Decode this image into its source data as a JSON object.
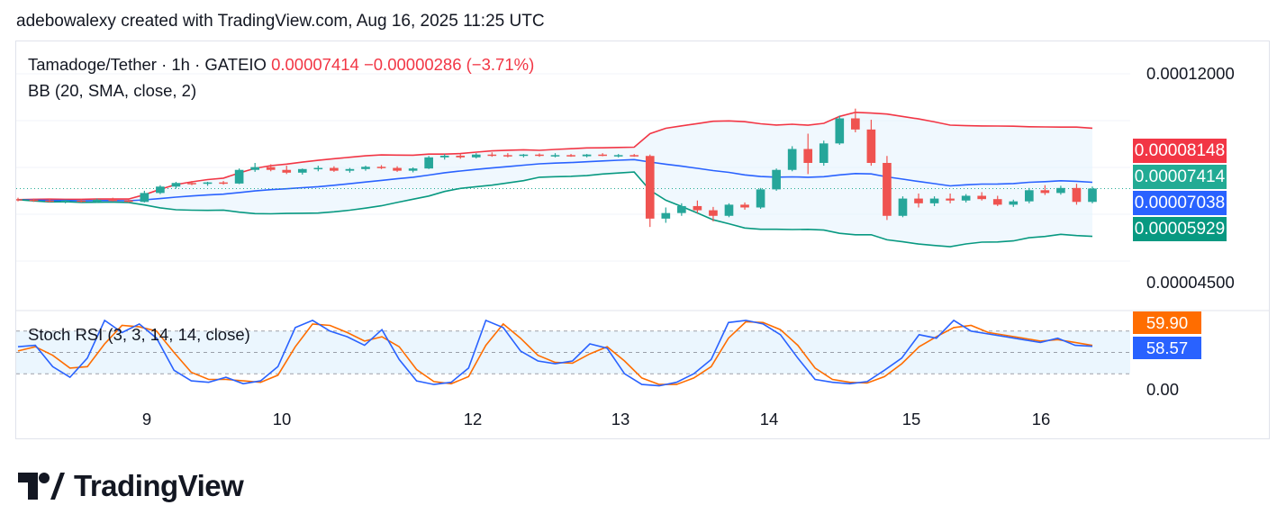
{
  "header": {
    "text": "adebowalexy created with TradingView.com, Aug 16, 2025 11:25 UTC"
  },
  "legend": {
    "symbol": "Tamadoge/Tether · 1h · GATEIO",
    "price": "0.00007414",
    "change": "−0.00000286 (−3.71%)",
    "indicator": "BB (20, SMA, close, 2)"
  },
  "stoch": {
    "title": "Stoch RSI (3, 3, 14, 14, close)"
  },
  "badges": {
    "upper": {
      "text": "0.00008148",
      "color": "#f23645"
    },
    "last": {
      "text": "0.00007414",
      "color": "#22ab94"
    },
    "basis": {
      "text": "0.00007038",
      "color": "#2962ff"
    },
    "lower": {
      "text": "0.00005929",
      "color": "#089981"
    },
    "stoch_d": {
      "text": "59.90",
      "color": "#ff6d00"
    },
    "stoch_k": {
      "text": "58.57",
      "color": "#2962ff"
    }
  },
  "colors": {
    "up": "#26a69a",
    "down": "#ef5350",
    "bb_upper": "#f23645",
    "bb_basis": "#2962ff",
    "bb_lower": "#089981",
    "band_fill": "#e3f2fd",
    "stoch_k": "#2962ff",
    "stoch_d": "#ff6d00"
  },
  "logo": {
    "text": "TradingView"
  },
  "chart_data": [
    {
      "type": "candlestick",
      "yaxis": {
        "ticks": [
          "0.00012000",
          "0.00004500"
        ]
      },
      "xaxis": {
        "ticks": [
          "9",
          "10",
          "12",
          "13",
          "14",
          "15",
          "16"
        ]
      },
      "candles": [
        [
          7.5e-05,
          7.55e-05,
          7.42e-05,
          7.48e-05
        ],
        [
          7.48e-05,
          7.52e-05,
          7.4e-05,
          7.45e-05
        ],
        [
          7.45e-05,
          7.5e-05,
          7.38e-05,
          7.42e-05
        ],
        [
          7.42e-05,
          7.48e-05,
          7.35e-05,
          7.45e-05
        ],
        [
          7.45e-05,
          7.5e-05,
          7.38e-05,
          7.4e-05
        ],
        [
          7.4e-05,
          7.52e-05,
          7.36e-05,
          7.48e-05
        ],
        [
          7.48e-05,
          7.55e-05,
          7.42e-05,
          7.46e-05
        ],
        [
          7.46e-05,
          7.5e-05,
          7.38e-05,
          7.4e-05
        ],
        [
          7.4e-05,
          7.8e-05,
          7.38e-05,
          7.72e-05
        ],
        [
          7.72e-05,
          8e-05,
          7.68e-05,
          7.95e-05
        ],
        [
          7.95e-05,
          8.12e-05,
          7.88e-05,
          8.08e-05
        ],
        [
          8.08e-05,
          8.15e-05,
          8e-05,
          8.05e-05
        ],
        [
          8.05e-05,
          8.12e-05,
          7.98e-05,
          8.1e-05
        ],
        [
          8.1e-05,
          8.15e-05,
          8.02e-05,
          8.06e-05
        ],
        [
          8.06e-05,
          8.6e-05,
          8.04e-05,
          8.55e-05
        ],
        [
          8.55e-05,
          8.8e-05,
          8.48e-05,
          8.65e-05
        ],
        [
          8.65e-05,
          8.75e-05,
          8.5e-05,
          8.55e-05
        ],
        [
          8.55e-05,
          8.7e-05,
          8.4e-05,
          8.45e-05
        ],
        [
          8.45e-05,
          8.6e-05,
          8.38e-05,
          8.58e-05
        ],
        [
          8.58e-05,
          8.7e-05,
          8.5e-05,
          8.62e-05
        ],
        [
          8.62e-05,
          8.68e-05,
          8.48e-05,
          8.52e-05
        ],
        [
          8.52e-05,
          8.62e-05,
          8.45e-05,
          8.58e-05
        ],
        [
          8.58e-05,
          8.7e-05,
          8.52e-05,
          8.66e-05
        ],
        [
          8.66e-05,
          8.72e-05,
          8.58e-05,
          8.62e-05
        ],
        [
          8.62e-05,
          8.68e-05,
          8.48e-05,
          8.52e-05
        ],
        [
          8.52e-05,
          8.64e-05,
          8.46e-05,
          8.6e-05
        ],
        [
          8.6e-05,
          9.05e-05,
          8.58e-05,
          9e-05
        ],
        [
          9e-05,
          9.12e-05,
          8.92e-05,
          9.06e-05
        ],
        [
          9.06e-05,
          9.12e-05,
          8.95e-05,
          9e-05
        ],
        [
          9e-05,
          9.15e-05,
          8.96e-05,
          9.1e-05
        ],
        [
          9.1e-05,
          9.18e-05,
          9.02e-05,
          9.08e-05
        ],
        [
          9.08e-05,
          9.15e-05,
          9e-05,
          9.06e-05
        ],
        [
          9.06e-05,
          9.12e-05,
          9e-05,
          9.1e-05
        ],
        [
          9.1e-05,
          9.14e-05,
          9.02e-05,
          9.06e-05
        ],
        [
          9.06e-05,
          9.15e-05,
          9e-05,
          9.08e-05
        ],
        [
          9.08e-05,
          9.12e-05,
          9.02e-05,
          9.04e-05
        ],
        [
          9.04e-05,
          9.12e-05,
          9e-05,
          9.1e-05
        ],
        [
          9.1e-05,
          9.15e-05,
          9.04e-05,
          9.06e-05
        ],
        [
          9.06e-05,
          9.12e-05,
          9e-05,
          9.08e-05
        ],
        [
          9.08e-05,
          9.12e-05,
          9.02e-05,
          9.05e-05
        ],
        [
          9.05e-05,
          9.1e-05,
          6.5e-05,
          6.8e-05
        ],
        [
          6.8e-05,
          7.2e-05,
          6.65e-05,
          7e-05
        ],
        [
          7e-05,
          7.35e-05,
          6.9e-05,
          7.25e-05
        ],
        [
          7.25e-05,
          7.45e-05,
          7e-05,
          7.1e-05
        ],
        [
          7.1e-05,
          7.22e-05,
          6.7e-05,
          6.9e-05
        ],
        [
          6.9e-05,
          7.35e-05,
          6.85e-05,
          7.3e-05
        ],
        [
          7.3e-05,
          7.38e-05,
          7.12e-05,
          7.2e-05
        ],
        [
          7.2e-05,
          7.9e-05,
          7.15e-05,
          7.85e-05
        ],
        [
          7.85e-05,
          8.6e-05,
          7.8e-05,
          8.55e-05
        ],
        [
          8.55e-05,
          9.4e-05,
          8.5e-05,
          9.3e-05
        ],
        [
          9.3e-05,
          9.85e-05,
          8.4e-05,
          8.8e-05
        ],
        [
          8.8e-05,
          9.6e-05,
          8.7e-05,
          9.5e-05
        ],
        [
          9.5e-05,
          0.000105,
          9.45e-05,
          0.000104
        ],
        [
          0.000104,
          0.0001075,
          9.9e-05,
          0.0001
        ],
        [
          0.0001,
          0.0001035,
          8.7e-05,
          8.8e-05
        ],
        [
          8.8e-05,
          9.05e-05,
          6.75e-05,
          6.9e-05
        ],
        [
          6.9e-05,
          7.6e-05,
          6.85e-05,
          7.52e-05
        ],
        [
          7.52e-05,
          7.7e-05,
          7.2e-05,
          7.35e-05
        ],
        [
          7.35e-05,
          7.6e-05,
          7.25e-05,
          7.52e-05
        ],
        [
          7.52e-05,
          7.7e-05,
          7.35e-05,
          7.45e-05
        ],
        [
          7.45e-05,
          7.68e-05,
          7.38e-05,
          7.62e-05
        ],
        [
          7.62e-05,
          7.75e-05,
          7.45e-05,
          7.5e-05
        ],
        [
          7.5e-05,
          7.62e-05,
          7.25e-05,
          7.3e-05
        ],
        [
          7.3e-05,
          7.48e-05,
          7.22e-05,
          7.42e-05
        ],
        [
          7.42e-05,
          7.9e-05,
          7.35e-05,
          7.82e-05
        ],
        [
          7.82e-05,
          8e-05,
          7.65e-05,
          7.72e-05
        ],
        [
          7.72e-05,
          7.98e-05,
          7.66e-05,
          7.9e-05
        ],
        [
          7.9e-05,
          8.05e-05,
          7.3e-05,
          7.4e-05
        ],
        [
          7.4e-05,
          7.95e-05,
          7.35e-05,
          7.88e-05
        ]
      ]
    },
    {
      "type": "line",
      "name": "Stoch RSI (3, 3, 14, 14, close)",
      "yaxis": {
        "ticks": [
          "0.00"
        ]
      },
      "k": [
        58,
        60,
        30,
        15,
        42,
        95,
        78,
        90,
        70,
        25,
        10,
        8,
        15,
        6,
        10,
        30,
        85,
        95,
        80,
        72,
        60,
        82,
        40,
        10,
        5,
        8,
        28,
        95,
        85,
        52,
        38,
        34,
        38,
        62,
        56,
        20,
        5,
        3,
        8,
        20,
        40,
        92,
        95,
        90,
        75,
        42,
        12,
        8,
        6,
        9,
        25,
        42,
        75,
        70,
        95,
        80,
        76,
        72,
        68,
        64,
        70,
        60,
        58.57
      ],
      "d": [
        52,
        58,
        46,
        28,
        30,
        62,
        88,
        86,
        80,
        50,
        22,
        12,
        12,
        10,
        8,
        18,
        58,
        90,
        88,
        78,
        66,
        72,
        58,
        26,
        9,
        6,
        16,
        60,
        90,
        70,
        46,
        36,
        35,
        48,
        58,
        38,
        14,
        5,
        5,
        14,
        30,
        70,
        93,
        92,
        82,
        60,
        28,
        12,
        8,
        7,
        16,
        34,
        58,
        72,
        85,
        88,
        78,
        74,
        70,
        66,
        68,
        64,
        59.9
      ]
    }
  ]
}
